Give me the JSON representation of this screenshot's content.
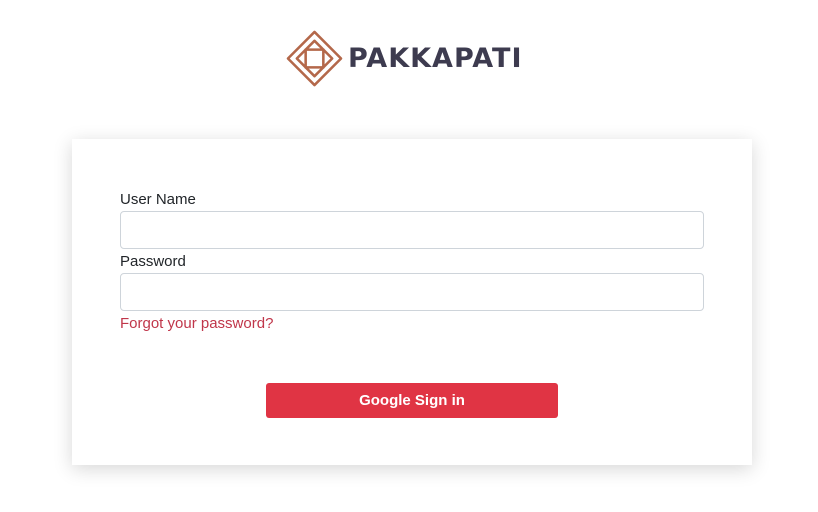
{
  "brand": {
    "name": "PAKKAPATI",
    "logo_icon": "diamond-lattice-logo",
    "logo_color": "#b4684a",
    "name_color": "#3d3b4f"
  },
  "login_form": {
    "username_label": "User Name",
    "username_value": "",
    "password_label": "Password",
    "password_value": "",
    "forgot_password_text": "Forgot your password?",
    "google_signin_label": "Google Sign in"
  },
  "colors": {
    "accent": "#e03444",
    "link": "#c0364a",
    "input_border": "#ced4da"
  }
}
